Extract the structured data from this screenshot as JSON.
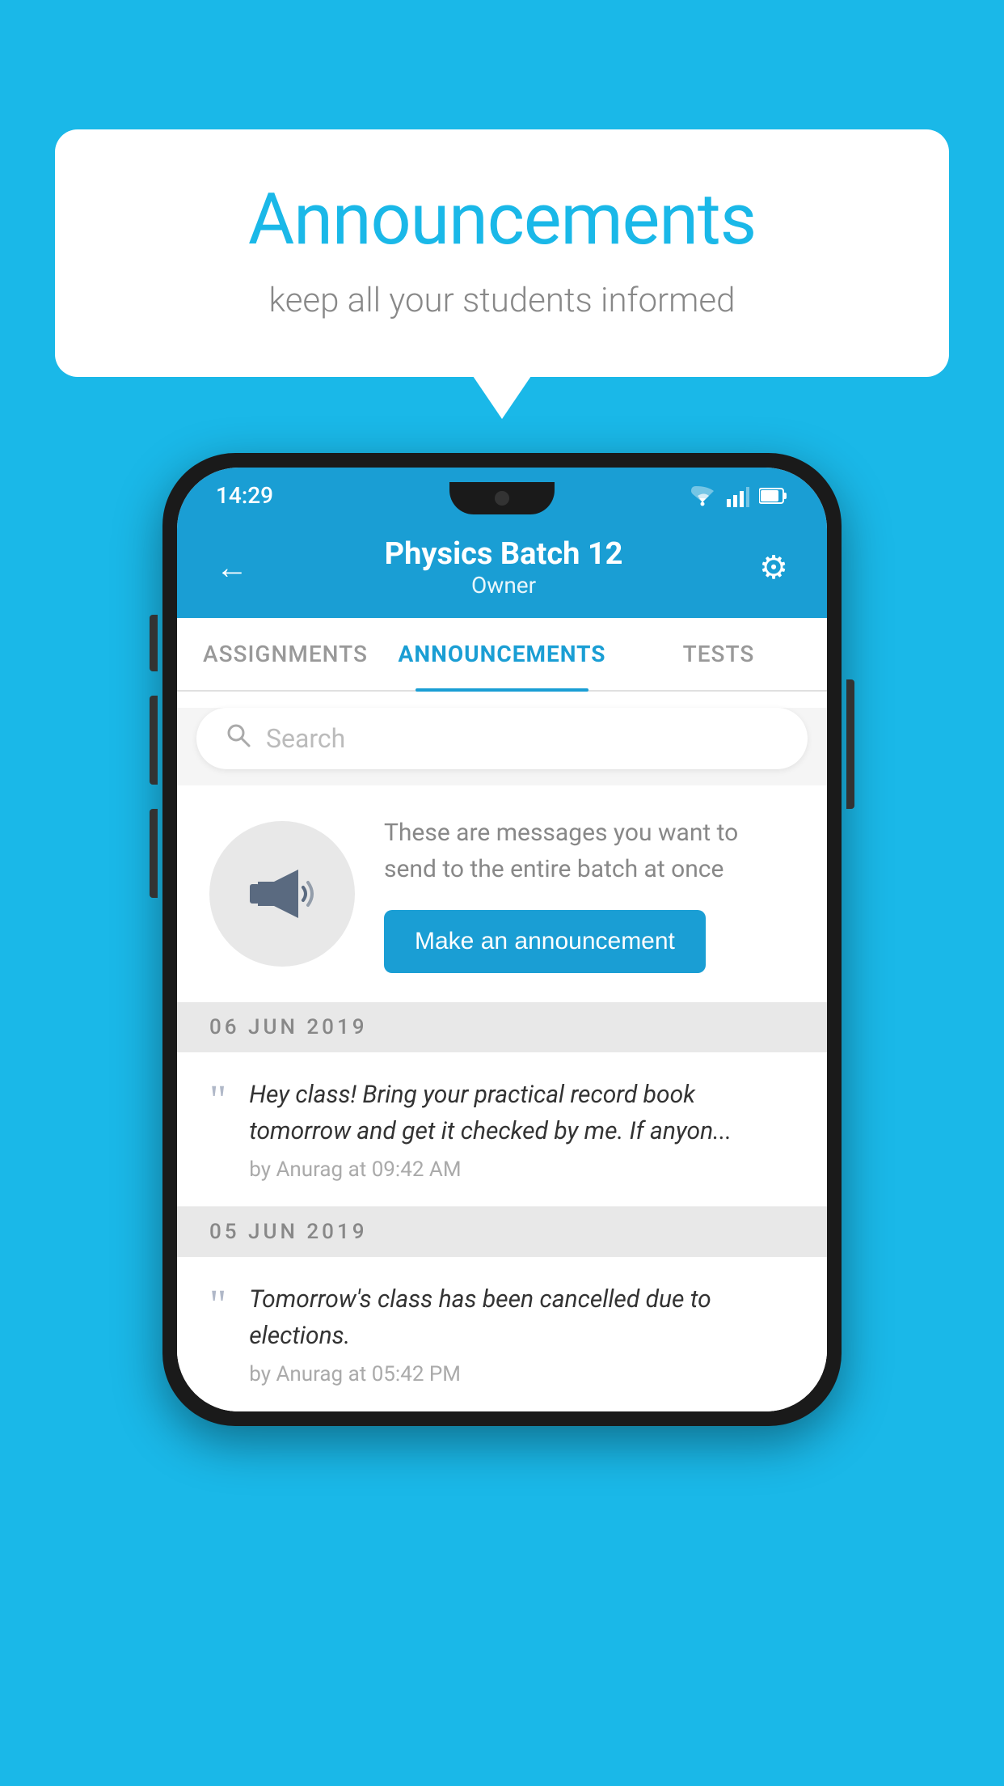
{
  "background_color": "#1ab8e8",
  "speech_bubble": {
    "title": "Announcements",
    "subtitle": "keep all your students informed"
  },
  "phone": {
    "status_bar": {
      "time": "14:29"
    },
    "header": {
      "title": "Physics Batch 12",
      "subtitle": "Owner",
      "back_label": "←",
      "settings_label": "⚙"
    },
    "tabs": [
      {
        "label": "ASSIGNMENTS",
        "active": false
      },
      {
        "label": "ANNOUNCEMENTS",
        "active": true
      },
      {
        "label": "TESTS",
        "active": false
      }
    ],
    "search": {
      "placeholder": "Search"
    },
    "announcement_prompt": {
      "message": "These are messages you want to send to the entire batch at once",
      "button_label": "Make an announcement"
    },
    "announcements": [
      {
        "date": "06  JUN  2019",
        "text": "Hey class! Bring your practical record book tomorrow and get it checked by me. If anyon...",
        "meta": "by Anurag at 09:42 AM"
      },
      {
        "date": "05  JUN  2019",
        "text": "Tomorrow's class has been cancelled due to elections.",
        "meta": "by Anurag at 05:42 PM"
      }
    ]
  }
}
